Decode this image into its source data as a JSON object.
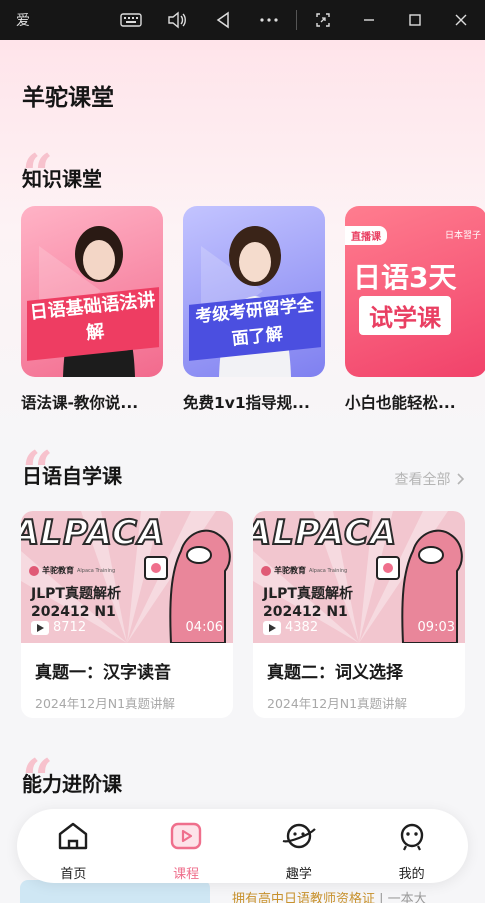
{
  "window": {
    "app_name": "爱",
    "icons": [
      "keyboard-icon",
      "volume-icon",
      "back-icon",
      "more-icon",
      "screenshot-icon",
      "minimize-icon",
      "maximize-icon",
      "close-icon"
    ]
  },
  "page": {
    "title": "羊驼课堂"
  },
  "knowledge": {
    "title": "知识课堂",
    "cards": [
      {
        "label": "语法课-教你说...",
        "banner": "日语基础语法讲解",
        "color": "#f07a9a"
      },
      {
        "label": "免费1v1指导规...",
        "banner": "考级考研留学全面了解",
        "color": "#8f8ff2"
      },
      {
        "label": "小白也能轻松...",
        "badge": "直播课",
        "banner_line1": "日语3天",
        "banner_line2": "试学课",
        "corner": "日本習子",
        "color": "#f2637b"
      }
    ]
  },
  "self_study": {
    "title": "日语自学课",
    "view_all": "查看全部",
    "courses": [
      {
        "brand": "羊驼教育",
        "brand_sub": "Alpaca Training",
        "thumb_line1": "JLPT真题解析",
        "thumb_line2": "202412 N1",
        "plays": "8712",
        "duration": "04:06",
        "name": "真题一：汉字读音",
        "subtitle": "2024年12月N1真题讲解"
      },
      {
        "brand": "羊驼教育",
        "brand_sub": "Alpaca Training",
        "thumb_line1": "JLPT真题解析",
        "thumb_line2": "202412 N1",
        "plays": "4382",
        "duration": "09:03",
        "name": "真题二：词义选择",
        "subtitle": "2024年12月N1真题讲解"
      }
    ],
    "alpaca_word": "ALPACA"
  },
  "advanced": {
    "title": "能力进阶课",
    "peek_text": "拥有高中日语教师资格证",
    "peek_text_more": "| 一本大"
  },
  "nav": {
    "items": [
      {
        "label": "首页",
        "icon": "home-icon",
        "active": false
      },
      {
        "label": "课程",
        "icon": "course-play-icon",
        "active": true
      },
      {
        "label": "趣学",
        "icon": "planet-icon",
        "active": false
      },
      {
        "label": "我的",
        "icon": "profile-face-icon",
        "active": false
      }
    ]
  },
  "colors": {
    "accent": "#ef6f8c",
    "quote": "#f7c2cd",
    "muted": "#a8a8a8"
  }
}
